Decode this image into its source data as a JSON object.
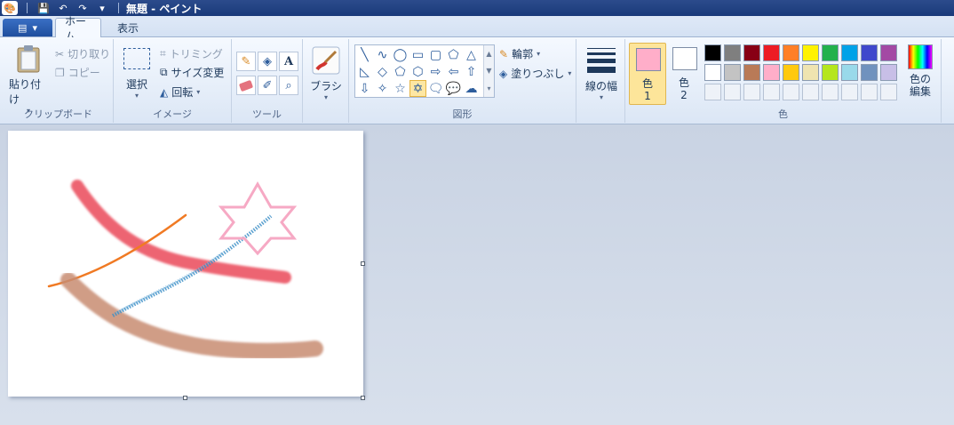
{
  "window": {
    "title": "無題 - ペイント"
  },
  "tabs": [
    {
      "label": "ホーム"
    },
    {
      "label": "表示"
    }
  ],
  "clipboard": {
    "paste_label": "貼り付け",
    "cut_label": "切り取り",
    "copy_label": "コピー",
    "group_label": "クリップボード"
  },
  "image": {
    "select_label": "選択",
    "crop_label": "トリミング",
    "resize_label": "サイズ変更",
    "rotate_label": "回転",
    "group_label": "イメージ"
  },
  "tools": {
    "group_label": "ツール",
    "items": [
      "pencil-icon",
      "fill-icon",
      "text-icon",
      "eraser-icon",
      "color-picker-icon",
      "magnifier-icon"
    ],
    "text_glyph": "A"
  },
  "brushes": {
    "label": "ブラシ"
  },
  "shapes": {
    "group_label": "図形",
    "outline_label": "輪郭",
    "fill_label": "塗りつぶし",
    "selected": "six-point-star"
  },
  "size": {
    "label": "線の幅"
  },
  "colors": {
    "group_label": "色",
    "color1_label": "色",
    "color1_num": "1",
    "color2_label": "色",
    "color2_num": "2",
    "edit_label_1": "色の",
    "edit_label_2": "編集",
    "color1": "#ffaec9",
    "color2": "#ffffff",
    "palette_row1": [
      "#000000",
      "#7f7f7f",
      "#880015",
      "#ed1c24",
      "#ff7f27",
      "#fff200",
      "#22b14c",
      "#00a2e8",
      "#3f48cc",
      "#a349a4"
    ],
    "palette_row2": [
      "#ffffff",
      "#c3c3c3",
      "#b97a57",
      "#ffaec9",
      "#ffc90e",
      "#efe4b0",
      "#b5e61d",
      "#99d9ea",
      "#7092be",
      "#c8bfe7"
    ]
  }
}
